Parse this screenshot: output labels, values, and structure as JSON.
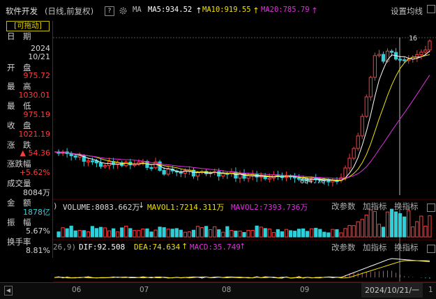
{
  "header": {
    "title": "软件开发",
    "mode": "(日线,前复权)",
    "help": "?",
    "ma_label": "MA",
    "ma5": "MA5:934.52",
    "ma10": "MA10:919.55",
    "ma20": "MA20:785.79",
    "arrow_up": "↑",
    "settings": "设置均线"
  },
  "left_panel": {
    "drag_tag": "[可拖动]",
    "items": [
      {
        "label": "日　期",
        "value": "2024",
        "value2": "10/21",
        "color": "white"
      },
      {
        "label": "开　盘",
        "value": "975.72",
        "color": "red"
      },
      {
        "label": "最　高",
        "value": "1030.01",
        "color": "red"
      },
      {
        "label": "最　低",
        "value": "975.19",
        "color": "red"
      },
      {
        "label": "收　盘",
        "value": "1021.19",
        "color": "red"
      },
      {
        "label": "涨　跌",
        "value": "▲ 54.36",
        "color": "red"
      },
      {
        "label": "涨跌幅",
        "value": "+5.62%",
        "color": "red"
      },
      {
        "label": "成交量",
        "value": "8084万",
        "color": "white"
      },
      {
        "label": "金　额",
        "value": "1878亿",
        "color": "cyan"
      },
      {
        "label": "振　幅",
        "value": "5.67%",
        "color": "white"
      },
      {
        "label": "换手率",
        "value": "8.81%",
        "color": "white"
      }
    ]
  },
  "price_chart": {
    "high_marker": "16",
    "low_marker": "684.76"
  },
  "volume_panel": {
    "prefix": ")",
    "volume": "VOLUME:8083.662万",
    "down_arrow": "↓",
    "mavol1": "MAVOL1:7214.311万",
    "mavol2": "MAVOL2:7393.736万",
    "change_param": "改参数",
    "add_indicator": "加指标",
    "switch_indicator": "换指标"
  },
  "macd_panel": {
    "prefix": "26,9)",
    "dif": "DIF:92.508",
    "dea": "DEA:74.634",
    "macd": "MACD:35.749",
    "change_param": "改参数",
    "add_indicator": "加指标",
    "switch_indicator": "换指标"
  },
  "x_axis": {
    "ticks": [
      "06",
      "07",
      "08",
      "09"
    ],
    "cursor_date": "2024/10/21/一",
    "right_edge": "1"
  },
  "colors": {
    "up": "#ff3c3c",
    "down": "#2ecfd8",
    "ma5": "#ffffff",
    "ma10": "#f0e000",
    "ma20": "#e030e0"
  }
}
